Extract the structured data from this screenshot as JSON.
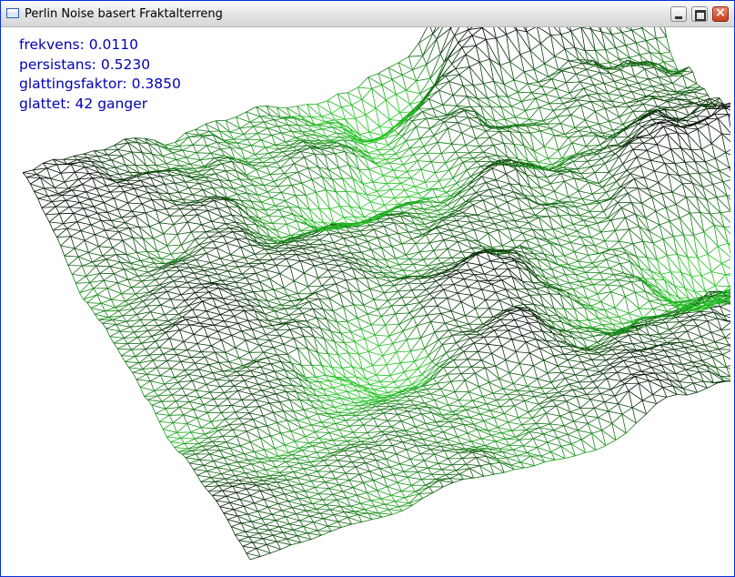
{
  "window": {
    "title": "Perlin Noise basert Fraktalterreng",
    "buttons": {
      "minimize": "minimize",
      "maximize": "maximize",
      "close": "×"
    }
  },
  "hud": {
    "frekvens": "frekvens: 0.0110",
    "persistans": "persistans: 0.5230",
    "glattingsfaktor": "glattingsfaktor: 0.3850",
    "glattet": "glattet: 42 ganger"
  },
  "colors": {
    "hud_text": "#0000b4",
    "wire_high": "#000000",
    "wire_low": "#23c323",
    "background": "#ffffff"
  }
}
